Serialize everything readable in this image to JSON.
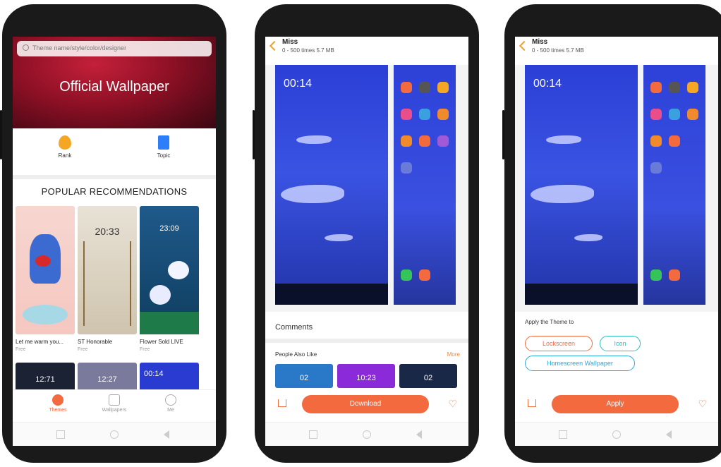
{
  "phone1": {
    "search_placeholder": "Theme name/style/color/designer",
    "banner_title": "Official Wallpaper",
    "quick_links": [
      "Rank",
      "Topic"
    ],
    "section_title": "POPULAR RECOMMENDATIONS",
    "items": [
      {
        "title": "Let me warm you...",
        "price": "Free"
      },
      {
        "title": "ST Honorable",
        "price": "Free"
      },
      {
        "title": "Flower Sold LIVE",
        "price": "Free"
      }
    ],
    "thumb_times": [
      "20:33",
      "23:09"
    ],
    "row2_times": [
      "12:71",
      "12:27",
      "00:14"
    ],
    "bottom_nav": [
      "Themes",
      "Wallpapers",
      "Me"
    ]
  },
  "phone2": {
    "title": "Miss",
    "meta": "0 - 500 times  5.7 MB",
    "lock_time": "00:14",
    "comments_label": "Comments",
    "also_like_label": "People Also Like",
    "more_label": "More",
    "also_like_times": [
      "02",
      "10:23",
      "02"
    ],
    "button_label": "Download"
  },
  "phone3": {
    "title": "Miss",
    "meta": "0 - 500 times  5.7 MB",
    "lock_time": "00:14",
    "apply_label": "Apply the Theme to",
    "chips": [
      "Lockscreen",
      "Icon",
      "Homescreen Wallpaper"
    ],
    "button_label": "Apply"
  },
  "colors": {
    "accent": "#f36a3e",
    "chip_teal": "#2bbfbf",
    "chip_blue": "#2aa8d8",
    "wallpaper_blue": "#2f45dc"
  }
}
